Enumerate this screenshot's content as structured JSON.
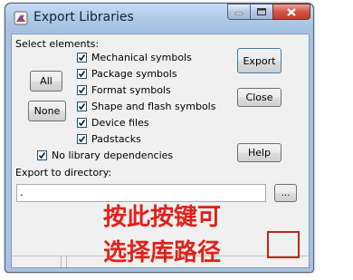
{
  "window": {
    "title": "Export Libraries",
    "app_icon": "export-libraries-app-icon"
  },
  "labels": {
    "select_elements": "Select elements:",
    "export_directory": "Export to directory:"
  },
  "checkboxes": [
    {
      "label": "Mechanical symbols",
      "checked": true
    },
    {
      "label": "Package symbols",
      "checked": true
    },
    {
      "label": "Format symbols",
      "checked": true
    },
    {
      "label": "Shape and flash symbols",
      "checked": true
    },
    {
      "label": "Device files",
      "checked": true
    },
    {
      "label": "Padstacks",
      "checked": true
    }
  ],
  "no_library_dependencies": {
    "label": "No library dependencies",
    "checked": true
  },
  "buttons": {
    "export": "Export",
    "close": "Close",
    "all": "All",
    "none": "None",
    "help": "Help",
    "browse": "..."
  },
  "directory_input": {
    "value": "."
  },
  "annotation": {
    "line1": "按此按键可",
    "line2": "选择库路径",
    "color": "#e0221b"
  }
}
